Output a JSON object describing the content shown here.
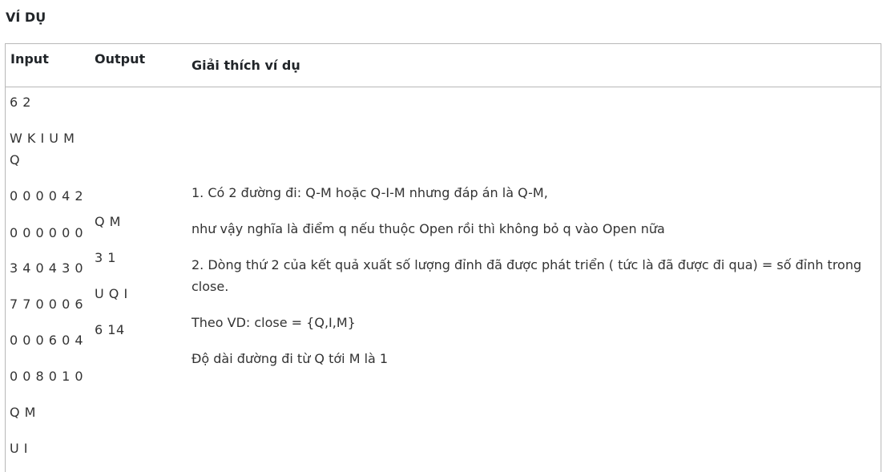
{
  "heading": "VÍ DỤ",
  "table": {
    "headers": {
      "input": "Input",
      "output": "Output",
      "explanation": "Giải thích ví dụ"
    },
    "input_lines": [
      "6 2",
      "W K I U M",
      "Q",
      "0 0 0 0 4 2",
      "0 0 0 0 0 0",
      "3 4 0 4 3 0",
      "7 7 0 0 0 6",
      "0 0 0 6 0 4",
      "0 0 8 0 1 0",
      "Q M",
      "U I"
    ],
    "output_lines": [
      "Q M",
      "3 1",
      "U Q I",
      "6 14"
    ],
    "explanation_lines": [
      "1. Có 2 đường đi: Q-M hoặc Q-I-M nhưng đáp án là Q-M,",
      "như vậy nghĩa là điểm q nếu thuộc Open rồi thì không bỏ q vào Open nữa",
      "2. Dòng thứ 2 của kết quả xuất số lượng đỉnh đã được phát triển ( tức là đã được đi qua) = số đỉnh trong",
      "close.",
      "Theo VD: close = {Q,I,M}",
      "Độ dài đường đi từ Q tới M là 1"
    ]
  }
}
